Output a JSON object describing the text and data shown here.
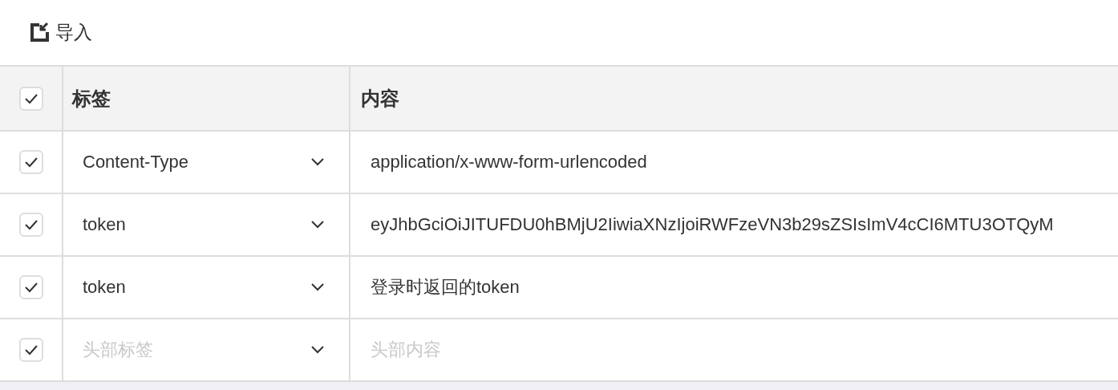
{
  "toolbar": {
    "import_button": "导入"
  },
  "table": {
    "header": {
      "checked": true,
      "columns": [
        "标签",
        "内容"
      ]
    },
    "rows": [
      {
        "checked": true,
        "key": {
          "value": "Content-Type"
        },
        "content": {
          "value": "application/x-www-form-urlencoded"
        }
      },
      {
        "checked": true,
        "key": {
          "value": "token"
        },
        "content": {
          "value": "eyJhbGciOiJITUFDU0hBMjU2IiwiaXNzIjoiRWFzeVN3b29sZSIsImV4cCI6MTU3OTQyM"
        }
      },
      {
        "checked": true,
        "key": {
          "value": "token"
        },
        "content": {
          "value": "登录时返回的token"
        }
      },
      {
        "checked": true,
        "key": {
          "placeholder": "头部标签"
        },
        "content": {
          "placeholder": "头部内容"
        }
      }
    ]
  }
}
